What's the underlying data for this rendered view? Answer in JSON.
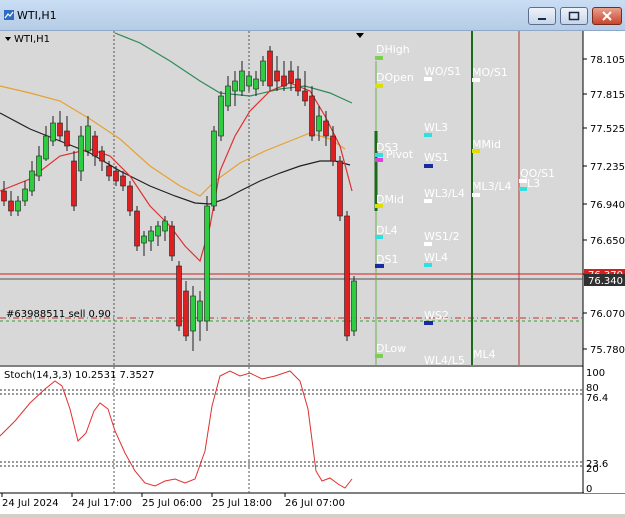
{
  "window": {
    "title": "WTI,H1"
  },
  "chart": {
    "label": "WTI,H1",
    "y_ticks": [
      "78.105",
      "77.815",
      "77.525",
      "77.235",
      "76.940",
      "76.650",
      "76.360",
      "76.070",
      "75.780"
    ],
    "current_price": "76.340",
    "marker_price": "76.370",
    "order_label": "#63988511 sell 0.90",
    "x_ticks": [
      "24 Jul 2024",
      "24 Jul 17:00",
      "25 Jul 06:00",
      "25 Jul 18:00",
      "26 Jul 07:00"
    ],
    "pivot_labels": {
      "dhigh": "DHigh",
      "dopen": "DOpen",
      "wo_s1": "WO/S1",
      "mo_s1": "MO/S1",
      "wl3": "WL3",
      "mmid": "MMid",
      "ds3": "DS3",
      "pivot": "Pivot",
      "ws1": "WS1",
      "qo_s1": "QO/S1",
      "ml3_l4": "ML3/L4",
      "l3": "L3",
      "wl3_l4": "WL3/L4",
      "dmid": "DMid",
      "dl4": "DL4",
      "ws1_2": "WS1/2",
      "ds1": "DS1",
      "wl4": "WL4",
      "ws2": "WS2",
      "dlow": "DLow",
      "wl4_l5": "WL4/L5",
      "ml4": "ML4"
    },
    "indicator": {
      "label": "Stoch(14,3,3) 10.2531 7.3527",
      "y_ticks": [
        "100",
        "80",
        "76.4",
        "23.6",
        "20",
        "0"
      ]
    }
  }
}
